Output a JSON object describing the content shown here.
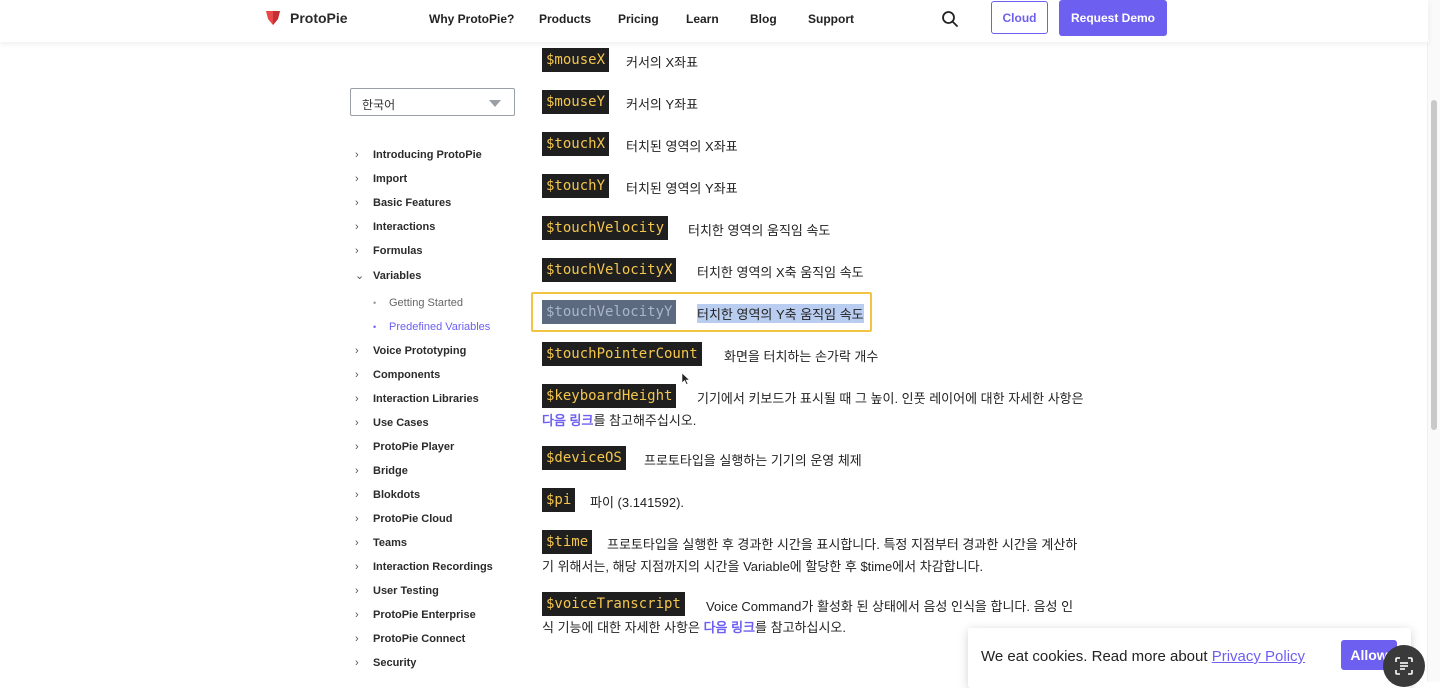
{
  "header": {
    "brand": "ProtoPie",
    "nav": [
      "Why ProtoPie?",
      "Products",
      "Pricing",
      "Learn",
      "Blog",
      "Support"
    ],
    "cloud_label": "Cloud",
    "demo_label": "Request Demo",
    "accent_color": "#6d5ff0"
  },
  "sidebar": {
    "language": "한국어",
    "items": [
      {
        "label": "Introducing ProtoPie",
        "chevron": "›"
      },
      {
        "label": "Import",
        "chevron": "›"
      },
      {
        "label": "Basic Features",
        "chevron": "›"
      },
      {
        "label": "Interactions",
        "chevron": "›"
      },
      {
        "label": "Formulas",
        "chevron": "›"
      },
      {
        "label": "Variables",
        "chevron": "⌄"
      },
      {
        "label": "Voice Prototyping",
        "chevron": "›"
      },
      {
        "label": "Components",
        "chevron": "›"
      },
      {
        "label": "Interaction Libraries",
        "chevron": "›"
      },
      {
        "label": "Use Cases",
        "chevron": "›"
      },
      {
        "label": "ProtoPie Player",
        "chevron": "›"
      },
      {
        "label": "Bridge",
        "chevron": "›"
      },
      {
        "label": "Blokdots",
        "chevron": "›"
      },
      {
        "label": "ProtoPie Cloud",
        "chevron": "›"
      },
      {
        "label": "Teams",
        "chevron": "›"
      },
      {
        "label": "Interaction Recordings",
        "chevron": "›"
      },
      {
        "label": "User Testing",
        "chevron": "›"
      },
      {
        "label": "ProtoPie Enterprise",
        "chevron": "›"
      },
      {
        "label": "ProtoPie Connect",
        "chevron": "›"
      },
      {
        "label": "Security",
        "chevron": "›"
      }
    ],
    "subitems": [
      {
        "label": "Getting Started",
        "bullet": "•"
      },
      {
        "label": "Predefined Variables",
        "bullet": "•"
      }
    ]
  },
  "variables": [
    {
      "code": "$mouseX",
      "desc": "커서의 X좌표"
    },
    {
      "code": "$mouseY",
      "desc": "커서의 Y좌표"
    },
    {
      "code": "$touchX",
      "desc": "터치된 영역의 X좌표"
    },
    {
      "code": "$touchY",
      "desc": "터치된 영역의 Y좌표"
    },
    {
      "code": "$touchVelocity",
      "desc": "터치한 영역의 움직임 속도"
    },
    {
      "code": "$touchVelocityX",
      "desc": "터치한 영역의 X축 움직임 속도"
    },
    {
      "code": "$touchVelocityY",
      "desc": "터치한 영역의 Y축 움직임 속도"
    },
    {
      "code": "$touchPointerCount",
      "desc": "화면을 터치하는 손가락 개수"
    },
    {
      "code": "$keyboardHeight",
      "desc": "기기에서 키보드가 표시될 때 그 높이. 인풋 레이어에 대한 자세한 사항은",
      "link": "다음 링크",
      "tail": "를 참고해주십시오."
    },
    {
      "code": "$deviceOS",
      "desc": "프로토타입을 실행하는 기기의 운영 체제"
    },
    {
      "code": "$pi",
      "desc": "파이 (3.141592)."
    },
    {
      "code": "$time",
      "desc": "프로토타입을 실행한 후 경과한 시간을 표시합니다. 특정 지점부터 경과한 시간을 계산하",
      "line2": "기 위해서는, 해당 지점까지의 시간을 Variable에 할당한 후 $time에서 차감합니다."
    },
    {
      "code": "$voiceTranscript",
      "desc": "Voice Command가 활성화 된 상태에서 음성 인식을 합니다. 음성 인",
      "line2a": "식 기능에 대한 자세한 사항은",
      "link": "다음 링크",
      "tail": "를 참고하십시오."
    }
  ],
  "cookie": {
    "text": "We eat cookies. Read more about",
    "link": "Privacy Policy",
    "allow": "Allow"
  },
  "icons": [
    "protopie-logo-icon",
    "search-icon",
    "chevron-right-icon",
    "chevron-down-icon",
    "mouse-cursor-icon",
    "screen-reader-icon"
  ]
}
